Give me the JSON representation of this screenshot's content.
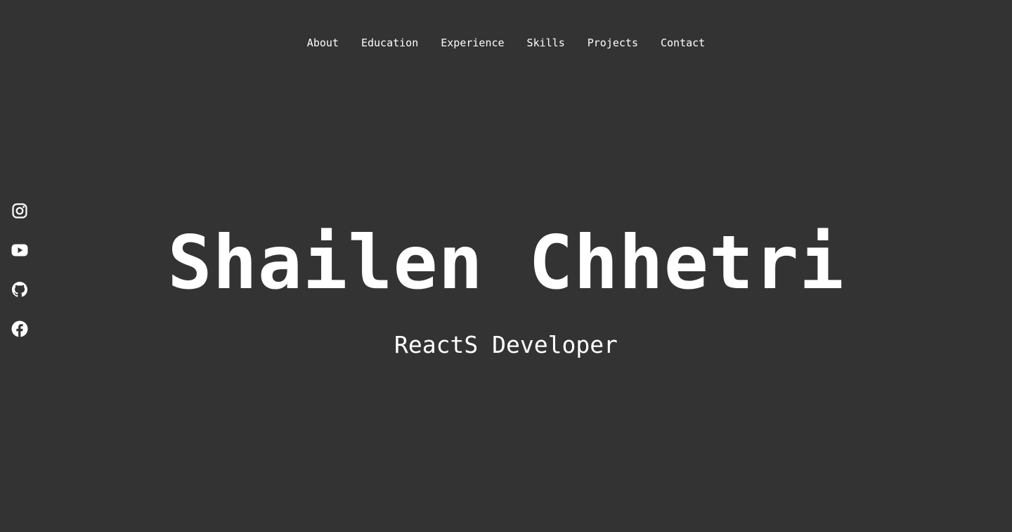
{
  "nav": {
    "items": [
      "About",
      "Education",
      "Experience",
      "Skills",
      "Projects",
      "Contact"
    ]
  },
  "social": {
    "icons": [
      "instagram-icon",
      "youtube-icon",
      "github-icon",
      "facebook-icon"
    ]
  },
  "hero": {
    "name": "Shailen Chhetri",
    "role": "ReactS Developer"
  },
  "colors": {
    "background": "#333333",
    "text": "#ffffff"
  }
}
